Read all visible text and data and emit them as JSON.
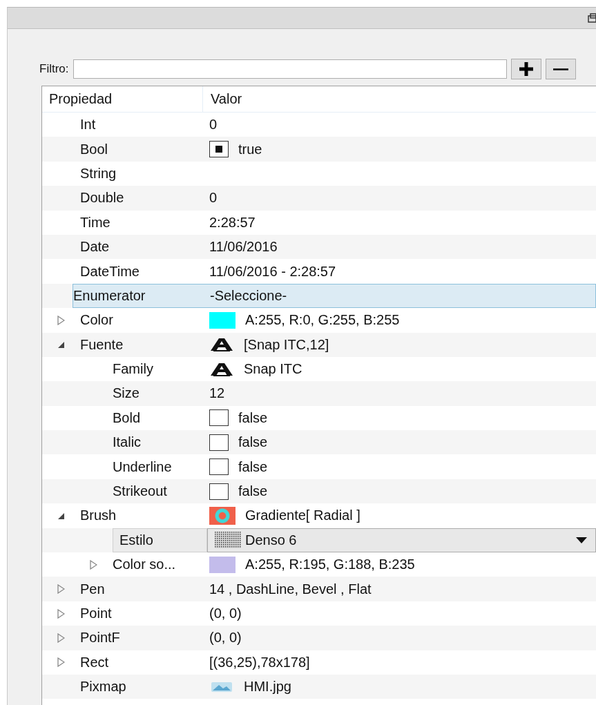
{
  "filter": {
    "label": "Filtro:"
  },
  "table": {
    "columns": [
      "Propiedad",
      "Valor"
    ],
    "rows": [
      {
        "name": "Int",
        "kind": "text",
        "value": "0",
        "selected": false
      },
      {
        "name": "Bool",
        "kind": "checkbox",
        "checked": true,
        "value": "true",
        "selected": false
      },
      {
        "name": "String",
        "kind": "text",
        "selected": false
      },
      {
        "name": "Double",
        "kind": "text",
        "value": "0",
        "selected": false
      },
      {
        "name": "Time",
        "kind": "text",
        "value": "2:28:57",
        "selected": false
      },
      {
        "name": "Date",
        "kind": "text",
        "value": "11/06/2016",
        "selected": false
      },
      {
        "name": "DateTime",
        "kind": "text",
        "value": "11/06/2016 - 2:28:57",
        "selected": false
      },
      {
        "name": "Enumerator",
        "kind": "text",
        "value": "-Seleccione-",
        "selected": true
      },
      {
        "name": "Color",
        "kind": "swatch",
        "color": "#00ffff",
        "value": "A:255, R:0, G:255, B:255",
        "expanded": false,
        "selected": false
      },
      {
        "name": "Fuente",
        "kind": "font",
        "value": "[Snap ITC,12]",
        "expanded": true,
        "selected": false,
        "children": [
          {
            "name": "Family",
            "kind": "font",
            "value": "Snap ITC",
            "selected": false
          },
          {
            "name": "Size",
            "kind": "text",
            "value": "12",
            "selected": false
          },
          {
            "name": "Bold",
            "kind": "checkbox",
            "checked": false,
            "value": "false",
            "selected": false
          },
          {
            "name": "Italic",
            "kind": "checkbox",
            "checked": false,
            "value": "false",
            "selected": false
          },
          {
            "name": "Underline",
            "kind": "checkbox",
            "checked": false,
            "value": "false",
            "selected": false
          },
          {
            "name": "Strikeout",
            "kind": "checkbox",
            "checked": false,
            "value": "false",
            "selected": false
          }
        ]
      },
      {
        "name": "Brush",
        "kind": "gradient",
        "value": "Gradiente[ Radial ]",
        "expanded": true,
        "selected": false,
        "children": [
          {
            "name": "Estilo",
            "kind": "combo",
            "value": "Denso 6",
            "selected": false
          },
          {
            "name": "Color so...",
            "kind": "swatch",
            "color": "#c3bceb",
            "value": "A:255, R:195, G:188, B:235",
            "expanded": false,
            "selected": false
          }
        ]
      },
      {
        "name": "Pen",
        "kind": "text",
        "value": "14 , DashLine, Bevel , Flat",
        "expanded": false,
        "selected": false
      },
      {
        "name": "Point",
        "kind": "text",
        "value": "(0, 0)",
        "expanded": false,
        "selected": false
      },
      {
        "name": "PointF",
        "kind": "text",
        "value": "(0, 0)",
        "expanded": false,
        "selected": false
      },
      {
        "name": "Rect",
        "kind": "text",
        "value": "[(36,25),78x178]",
        "expanded": false,
        "selected": false
      },
      {
        "name": "Pixmap",
        "kind": "image",
        "value": "HMI.jpg",
        "selected": false
      }
    ]
  }
}
